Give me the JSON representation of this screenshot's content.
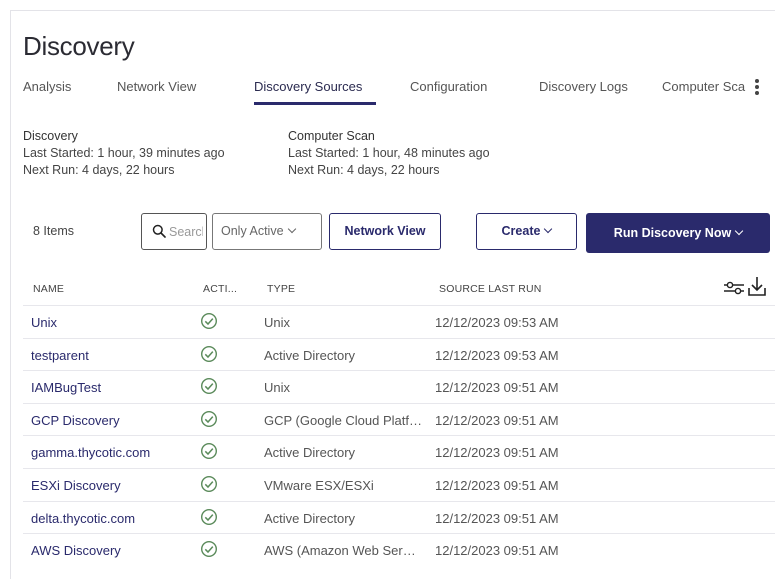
{
  "page": {
    "title": "Discovery"
  },
  "tabs": [
    {
      "label": "Analysis",
      "active": false
    },
    {
      "label": "Network View",
      "active": false
    },
    {
      "label": "Discovery Sources",
      "active": true
    },
    {
      "label": "Configuration",
      "active": false
    },
    {
      "label": "Discovery Logs",
      "active": false
    },
    {
      "label": "Computer Scan",
      "active": false
    }
  ],
  "more_menu_icon": "kebab-vertical-icon",
  "summary": {
    "discovery": {
      "heading": "Discovery",
      "last_started": "Last Started: 1 hour, 39 minutes ago",
      "next_run": "Next Run: 4 days, 22 hours"
    },
    "computer_scan": {
      "heading": "Computer Scan",
      "last_started": "Last Started: 1 hour, 48 minutes ago",
      "next_run": "Next Run: 4 days, 22 hours"
    }
  },
  "toolbar": {
    "item_count": "8 Items",
    "search_placeholder": "Search",
    "filter_selected": "Only Active",
    "network_view_label": "Network View",
    "create_label": "Create",
    "run_discovery_label": "Run Discovery Now"
  },
  "table": {
    "columns": [
      "NAME",
      "ACTI...",
      "TYPE",
      "SOURCE LAST RUN"
    ],
    "rows": [
      {
        "name": "Unix",
        "active": true,
        "type": "Unix",
        "last_run": "12/12/2023 09:53 AM"
      },
      {
        "name": "testparent",
        "active": true,
        "type": "Active Directory",
        "last_run": "12/12/2023 09:53 AM"
      },
      {
        "name": "IAMBugTest",
        "active": true,
        "type": "Unix",
        "last_run": "12/12/2023 09:51 AM"
      },
      {
        "name": "GCP Discovery",
        "active": true,
        "type": "GCP (Google Cloud Platform)",
        "last_run": "12/12/2023 09:51 AM"
      },
      {
        "name": "gamma.thycotic.com",
        "active": true,
        "type": "Active Directory",
        "last_run": "12/12/2023 09:51 AM"
      },
      {
        "name": "ESXi Discovery",
        "active": true,
        "type": "VMware ESX/ESXi",
        "last_run": "12/12/2023 09:51 AM"
      },
      {
        "name": "delta.thycotic.com",
        "active": true,
        "type": "Active Directory",
        "last_run": "12/12/2023 09:51 AM"
      },
      {
        "name": "AWS Discovery",
        "active": true,
        "type": "AWS (Amazon Web Services)",
        "last_run": "12/12/2023 09:51 AM"
      }
    ]
  },
  "colors": {
    "accent": "#2a2a6c",
    "active_check": "#5a8a5a",
    "row_divider": "#e7e7ec"
  }
}
